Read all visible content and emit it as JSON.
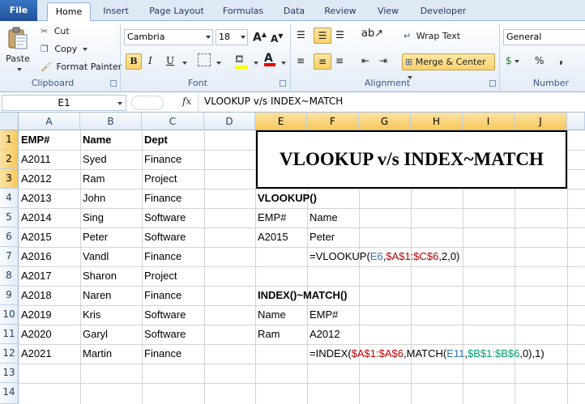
{
  "tabs": [
    "File",
    "Home",
    "Insert",
    "Page Layout",
    "Formulas",
    "Data",
    "Review",
    "View",
    "Developer"
  ],
  "ribbon": {
    "clipboard": {
      "paste": "Paste",
      "cut": "Cut",
      "copy": "Copy",
      "format_painter": "Format Painter",
      "label": "Clipboard"
    },
    "font": {
      "name": "Cambria",
      "size": "18",
      "bold": "B",
      "italic": "I",
      "underline": "U",
      "label": "Font",
      "grow": "A",
      "shrink": "A",
      "font_color_letter": "A"
    },
    "alignment": {
      "wrap_text": "Wrap Text",
      "merge_center": "Merge & Center",
      "label": "Alignment"
    },
    "number": {
      "format": "General",
      "currency": "$",
      "percent": "%",
      "comma": ",",
      "label": "Number"
    }
  },
  "formula_bar": {
    "name_box": "E1",
    "fx": "fx",
    "formula": "VLOOKUP v/s INDEX~MATCH"
  },
  "columns": [
    "A",
    "B",
    "C",
    "D",
    "E",
    "F",
    "G",
    "H",
    "I",
    "J"
  ],
  "rows": [
    "1",
    "2",
    "3",
    "4",
    "5",
    "6",
    "7",
    "8",
    "9",
    "10",
    "11",
    "12",
    "13",
    "14"
  ],
  "table": {
    "headers": [
      "EMP#",
      "Name",
      "Dept"
    ],
    "records": [
      [
        "A2011",
        "Syed",
        "Finance"
      ],
      [
        "A2012",
        "Ram",
        "Project"
      ],
      [
        "A2013",
        "John",
        "Finance"
      ],
      [
        "A2014",
        "Sing",
        "Software"
      ],
      [
        "A2015",
        "Peter",
        "Software"
      ],
      [
        "A2016",
        "Vandl",
        "Finance"
      ],
      [
        "A2017",
        "Sharon",
        "Project"
      ],
      [
        "A2018",
        "Naren",
        "Finance"
      ],
      [
        "A2019",
        "Kris",
        "Software"
      ],
      [
        "A2020",
        "Garyl",
        "Software"
      ],
      [
        "A2021",
        "Martin",
        "Finance"
      ]
    ]
  },
  "title_cell": "VLOOKUP v/s INDEX~MATCH",
  "vlookup": {
    "heading": "VLOOKUP()",
    "lbl_emp": "EMP#",
    "lbl_name": "Name",
    "val_emp": "A2015",
    "val_name": "Peter",
    "formula": {
      "p1": "=VLOOKUP(",
      "p2": "E6",
      "p3": ",",
      "p4": "$A$1:$C$6",
      "p5": ",2,0)"
    }
  },
  "index_match": {
    "heading": "INDEX()~MATCH()",
    "lbl_name": "Name",
    "lbl_emp": "EMP#",
    "val_name": "Ram",
    "val_emp": "A2012",
    "formula": {
      "p1": "=INDEX(",
      "p2": "$A$1:$A$6",
      "p3": ",MATCH(",
      "p4": "E11",
      "p5": ",",
      "p6": "$B$1:$B$6",
      "p7": ",0),1)"
    }
  }
}
